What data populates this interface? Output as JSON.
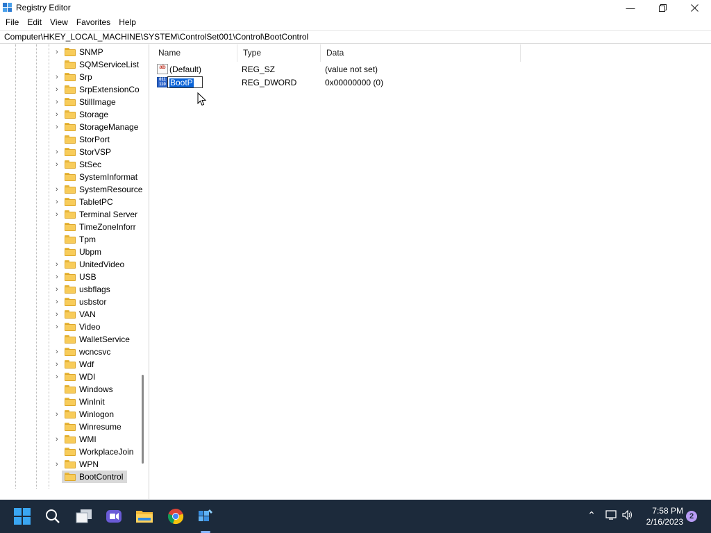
{
  "window": {
    "title": "Registry Editor",
    "controls": [
      "minimize",
      "maximize",
      "close"
    ]
  },
  "menu": [
    "File",
    "Edit",
    "View",
    "Favorites",
    "Help"
  ],
  "address": "Computer\\HKEY_LOCAL_MACHINE\\SYSTEM\\ControlSet001\\Control\\BootControl",
  "tree": {
    "items": [
      {
        "label": "SNMP",
        "expandable": true
      },
      {
        "label": "SQMServiceList",
        "expandable": false
      },
      {
        "label": "Srp",
        "expandable": true
      },
      {
        "label": "SrpExtensionCo",
        "expandable": true
      },
      {
        "label": "StillImage",
        "expandable": true
      },
      {
        "label": "Storage",
        "expandable": true
      },
      {
        "label": "StorageManage",
        "expandable": true
      },
      {
        "label": "StorPort",
        "expandable": false
      },
      {
        "label": "StorVSP",
        "expandable": true
      },
      {
        "label": "StSec",
        "expandable": true
      },
      {
        "label": "SystemInformat",
        "expandable": false
      },
      {
        "label": "SystemResource",
        "expandable": true
      },
      {
        "label": "TabletPC",
        "expandable": true
      },
      {
        "label": "Terminal Server",
        "expandable": true
      },
      {
        "label": "TimeZoneInforr",
        "expandable": false
      },
      {
        "label": "Tpm",
        "expandable": false
      },
      {
        "label": "Ubpm",
        "expandable": false
      },
      {
        "label": "UnitedVideo",
        "expandable": true
      },
      {
        "label": "USB",
        "expandable": true
      },
      {
        "label": "usbflags",
        "expandable": true
      },
      {
        "label": "usbstor",
        "expandable": true
      },
      {
        "label": "VAN",
        "expandable": true
      },
      {
        "label": "Video",
        "expandable": true
      },
      {
        "label": "WalletService",
        "expandable": false
      },
      {
        "label": "wcncsvc",
        "expandable": true
      },
      {
        "label": "Wdf",
        "expandable": true
      },
      {
        "label": "WDI",
        "expandable": true
      },
      {
        "label": "Windows",
        "expandable": false
      },
      {
        "label": "WinInit",
        "expandable": false
      },
      {
        "label": "Winlogon",
        "expandable": true
      },
      {
        "label": "Winresume",
        "expandable": false
      },
      {
        "label": "WMI",
        "expandable": true
      },
      {
        "label": "WorkplaceJoin",
        "expandable": false
      },
      {
        "label": "WPN",
        "expandable": true
      },
      {
        "label": "BootControl",
        "expandable": false,
        "selected": true
      }
    ]
  },
  "values": {
    "columns": [
      "Name",
      "Type",
      "Data"
    ],
    "rows": [
      {
        "name": "(Default)",
        "type": "REG_SZ",
        "data": "(value not set)",
        "icon": "string-value-icon",
        "editing": false
      },
      {
        "name": "BootP",
        "type": "REG_DWORD",
        "data": "0x00000000 (0)",
        "icon": "binary-value-icon",
        "editing": true
      }
    ]
  },
  "taskbar": {
    "apps": [
      "start-icon",
      "search-icon",
      "task-view-icon",
      "meet-icon",
      "file-explorer-icon",
      "chrome-icon",
      "registry-editor-icon"
    ],
    "time": "7:58 PM",
    "date": "2/16/2023",
    "notification_count": "2"
  }
}
